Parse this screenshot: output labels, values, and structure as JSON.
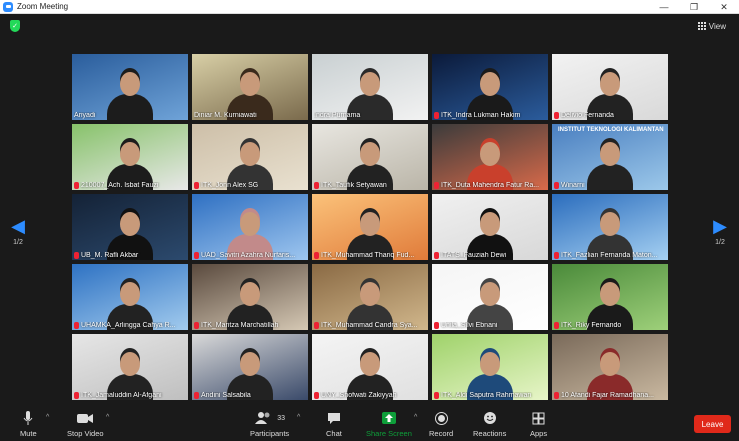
{
  "window": {
    "title": "Zoom Meeting",
    "minimize": "—",
    "restore": "❐",
    "close": "✕"
  },
  "view_label": "View",
  "page_indicator": "1/2",
  "participants_count": "33",
  "toolbar": {
    "mute": "Mute",
    "stop_video": "Stop Video",
    "participants": "Participants",
    "chat": "Chat",
    "share_screen": "Share Screen",
    "record": "Record",
    "reactions": "Reactions",
    "apps": "Apps",
    "leave": "Leave"
  },
  "colors": {
    "accent": "#2d8cff",
    "leave": "#e0291a",
    "share": "#0e9f3a",
    "active_speaker": "#e8e15a"
  },
  "tiles": [
    {
      "name": "Ariyadi",
      "muted": false
    },
    {
      "name": "Diniar M. Kurniawati",
      "muted": false,
      "active": true
    },
    {
      "name": "Indra Purnama",
      "muted": false
    },
    {
      "name": "ITK_Indra Lukman Hakim",
      "muted": true
    },
    {
      "name": "Delivio Fernanda",
      "muted": true
    },
    {
      "name": "210007_Ach. Isbat Fauzi",
      "muted": true
    },
    {
      "name": "ITK_Jonn Alex SG",
      "muted": true
    },
    {
      "name": "ITK_Taufik Setyawan",
      "muted": true
    },
    {
      "name": "ITK_Duta Mahendra Fatur Ra...",
      "muted": true
    },
    {
      "name": "Winarni",
      "muted": true
    },
    {
      "name": "UB_M. Rafli Akbar",
      "muted": true
    },
    {
      "name": "UAD_Savitri Azahra Nurfaris...",
      "muted": true
    },
    {
      "name": "ITK_Muhammad Thariq Fud...",
      "muted": true
    },
    {
      "name": "ITATS_Fauziah Dewi",
      "muted": true
    },
    {
      "name": "ITK_Fazlian Fernanda Maton...",
      "muted": true
    },
    {
      "name": "UHAMKA_Arlingga Cahya R...",
      "muted": true
    },
    {
      "name": "ITK_Maritza Marchatillah",
      "muted": true
    },
    {
      "name": "ITK_Muhammad Candra Sya...",
      "muted": true
    },
    {
      "name": "Unila_Silvi Ebnani",
      "muted": true
    },
    {
      "name": "ITK_Riky Fernando",
      "muted": true
    },
    {
      "name": "ITK_Jamaluddin Al-Afgani",
      "muted": true
    },
    {
      "name": "Andini Salsabila",
      "muted": true
    },
    {
      "name": "UNY_Shofwati Zakiyyah",
      "muted": true
    },
    {
      "name": "ITK_Aldi Saputra Rahmawan",
      "muted": true
    },
    {
      "name": "10 Afandi Fajar Ramadhana...",
      "muted": true
    }
  ],
  "banner_text": "INSTITUT TEKNOLOGI KALIMANTAN"
}
